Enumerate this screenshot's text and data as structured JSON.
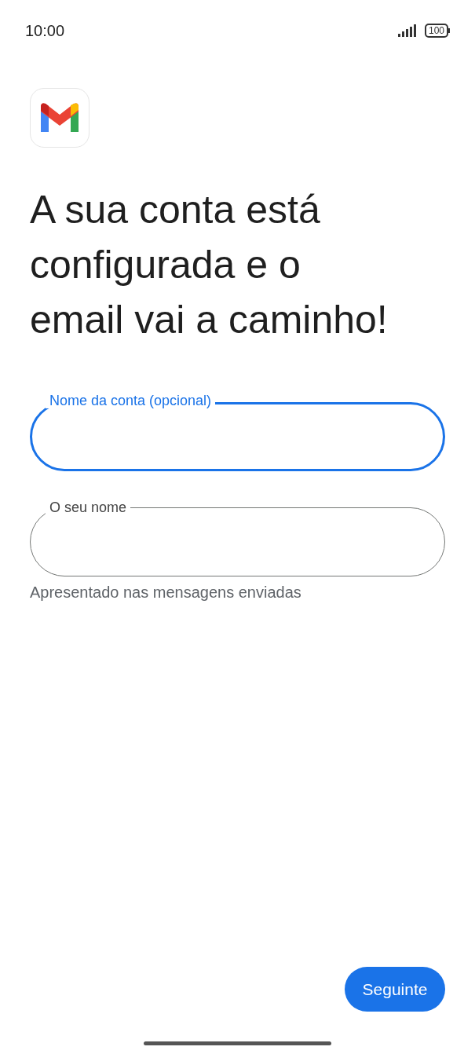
{
  "status_bar": {
    "time": "10:00",
    "battery": "100"
  },
  "heading": "A sua conta está configurada e o email vai a caminho!",
  "fields": [
    {
      "label": "Nome da conta (opcional)",
      "focused": true
    },
    {
      "label": "O seu nome",
      "focused": false,
      "helper": "Apresentado nas mensagens enviadas"
    }
  ],
  "next_button": "Seguinte"
}
